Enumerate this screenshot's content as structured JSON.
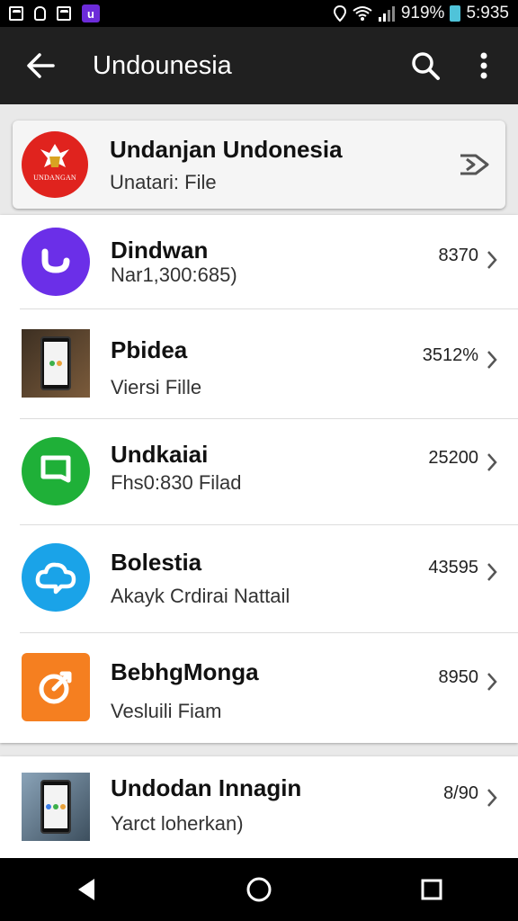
{
  "status_bar": {
    "battery_text": "919%",
    "time": "5:935"
  },
  "app_bar": {
    "title": "Undounesia"
  },
  "featured": {
    "title": "Undanjan Undonesia",
    "subtitle": "Unatari: File",
    "logo_text": "UNDANGAN"
  },
  "items": [
    {
      "name": "Dindwan",
      "desc": "Nar1,300:685)",
      "count": "8370",
      "icon": "circle-u-icon",
      "color": "#6b2fe8"
    },
    {
      "name": "Pbidea",
      "desc": "Viersi Fille",
      "count": "3512%",
      "icon": "phone-photo-icon",
      "color": "#3a2d20"
    },
    {
      "name": "Undkaiai",
      "desc": "Fhs0:830 Filad",
      "count": "25200",
      "icon": "chat-bubble-icon",
      "color": "#1fb038"
    },
    {
      "name": "Bolestia",
      "desc": "Akayk Crdirai Nattail",
      "count": "43595",
      "icon": "cloud-chat-icon",
      "color": "#1aa3e8"
    },
    {
      "name": "BebhgMonga",
      "desc": "Vesluili Fiam",
      "count": "8950",
      "icon": "target-icon",
      "color": "#f57f20"
    }
  ],
  "second_item": {
    "name": "Undodan Innagin",
    "desc": "Yarct loherkan)",
    "count": "8/90",
    "icon": "phone-hand-icon"
  }
}
